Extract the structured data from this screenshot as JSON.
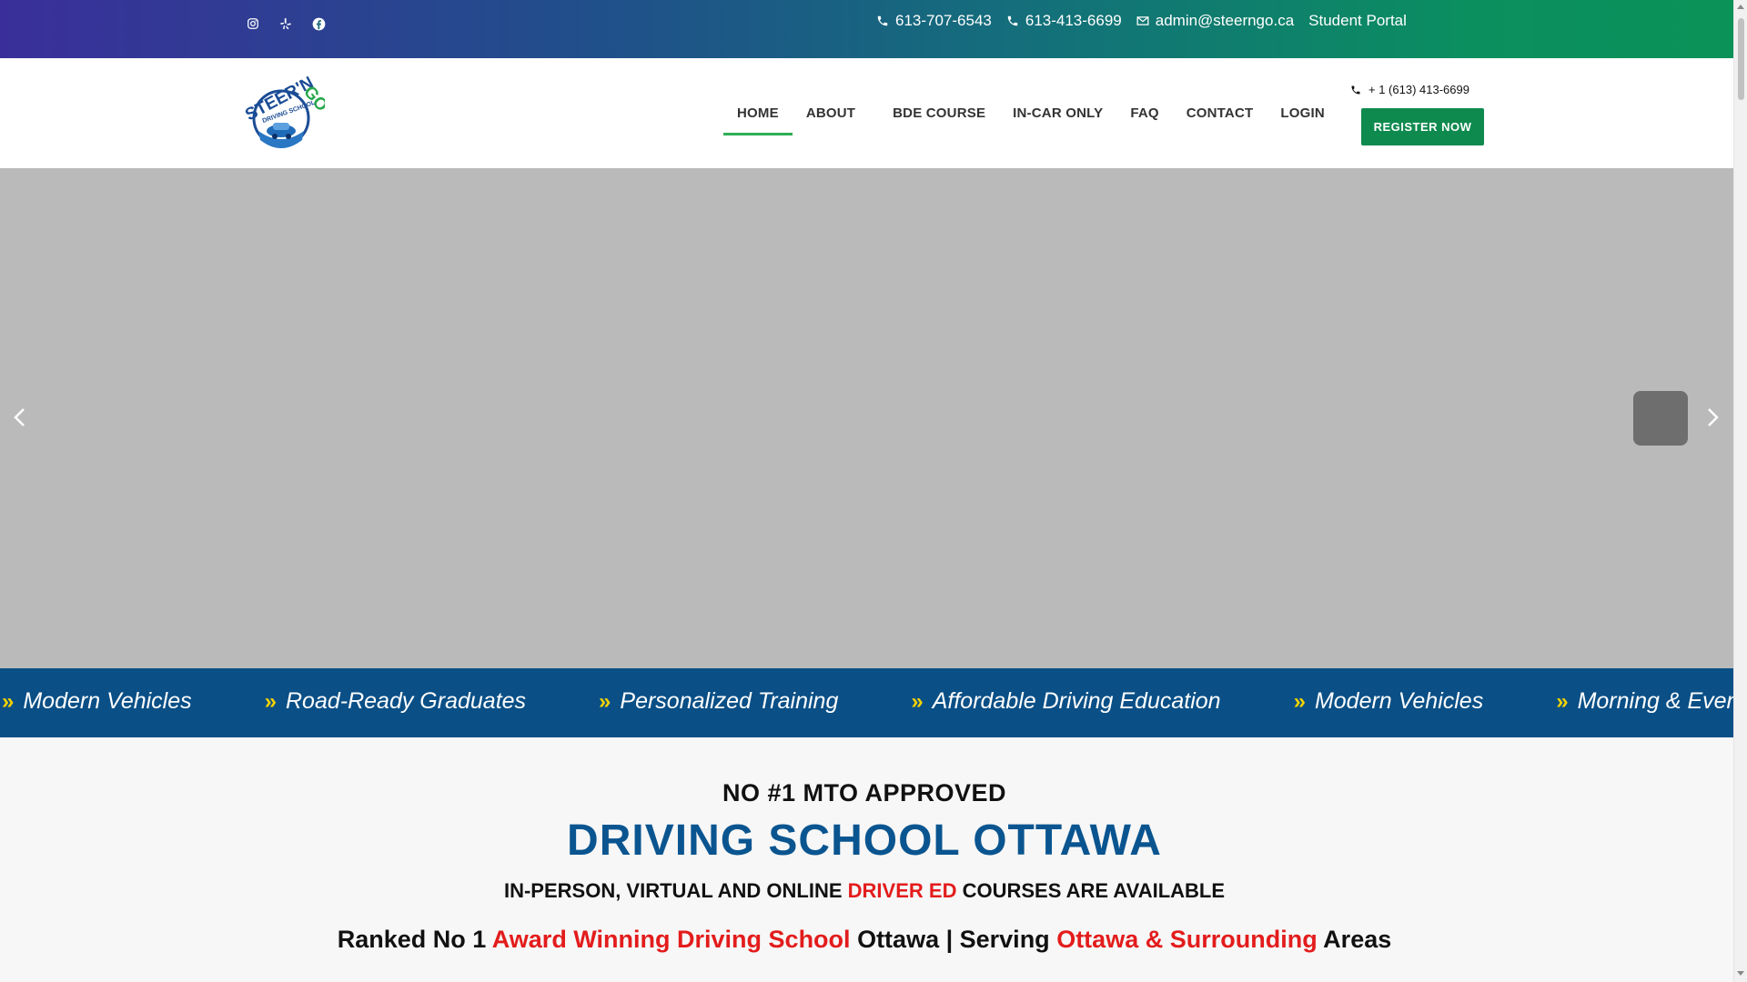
{
  "topbar": {
    "social": [
      {
        "icon": "instagram-icon"
      },
      {
        "icon": "yelp-icon"
      },
      {
        "icon": "facebook-icon"
      }
    ],
    "phone1": "613-707-6543",
    "phone2": "613-413-6699",
    "email": "admin@steerngo.ca",
    "portal": "Student Portal"
  },
  "header": {
    "logo_alt": "Steer'N Go Driving School",
    "nav": [
      "HOME",
      "ABOUT",
      "BDE COURSE",
      "IN-CAR ONLY",
      "FAQ",
      "CONTACT",
      "LOGIN"
    ],
    "phone": "+ 1 (613) 413-6699",
    "register": "REGISTER NOW"
  },
  "ticker": {
    "marker": "»",
    "items": [
      "Modern Vehicles",
      "Road-Ready Graduates",
      "Personalized Training",
      "Affordable Driving Education",
      "Modern Vehicles",
      "Morning & Evening C"
    ]
  },
  "intro": {
    "line1": "NO #1 MTO APPROVED",
    "line2": "DRIVING SCHOOL OTTAWA",
    "line3_a": "IN-PERSON, VIRTUAL AND ONLINE ",
    "line3_b": "DRIVER ED",
    "line3_c": " COURSES ARE AVAILABLE",
    "line4_a": "Ranked No 1 ",
    "line4_b": "Award Winning Driving School",
    "line4_c": " Ottawa | Serving ",
    "line4_d": "Ottawa & Surrounding",
    "line4_e": " Areas"
  },
  "colors": {
    "accent_green": "#0f8a4f",
    "brand_blue": "#0a5590",
    "highlight_red": "#e31c1c",
    "ticker_bg": "#0a4f86"
  }
}
